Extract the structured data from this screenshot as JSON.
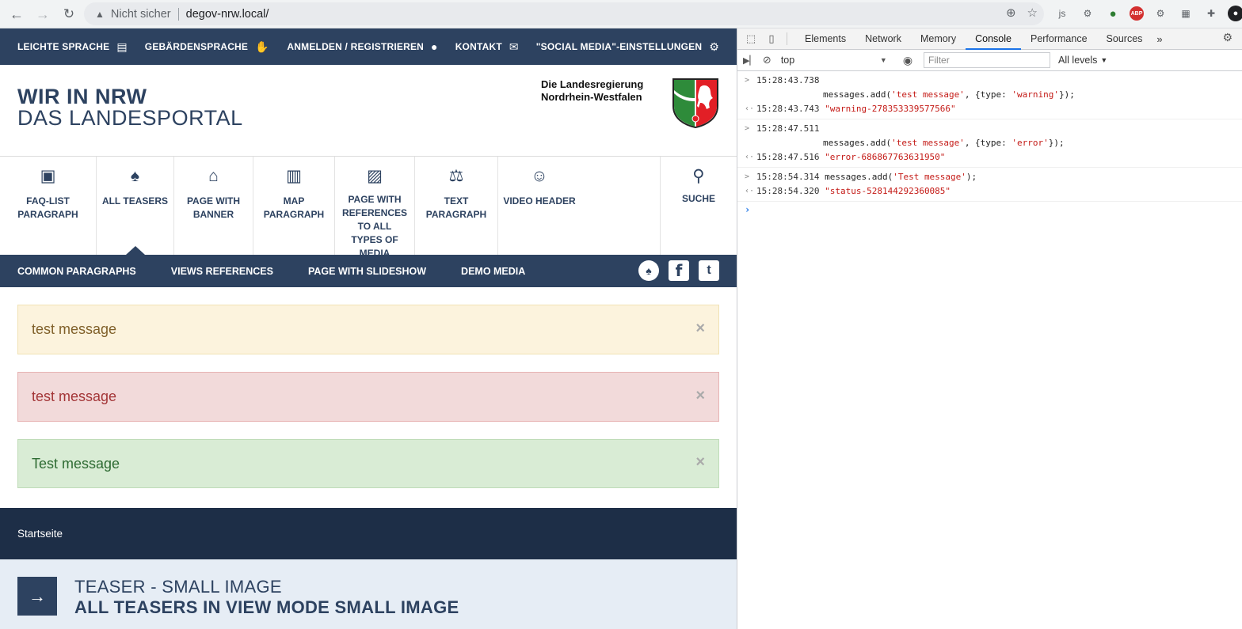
{
  "browser": {
    "security_label": "Nicht sicher",
    "url": "degov-nrw.local/",
    "icons": [
      "arrow-left-icon",
      "arrow-right-icon",
      "reload-icon",
      "warning-icon",
      "zoom-icon",
      "star-icon"
    ]
  },
  "extensions": {
    "js_label": "js",
    "abp_label": "ABP"
  },
  "site": {
    "topbar": {
      "left": [
        {
          "label": "LEICHTE SPRACHE",
          "icon": "book-icon"
        },
        {
          "label": "GEBÄRDENSPRACHE",
          "icon": "hand-icon"
        }
      ],
      "right": [
        {
          "label": "ANMELDEN / REGISTRIEREN",
          "icon": "user-icon"
        },
        {
          "label": "KONTAKT",
          "icon": "envelope-icon"
        },
        {
          "label": "\"SOCIAL MEDIA\"-EINSTELLUNGEN",
          "icon": "gears-icon"
        }
      ]
    },
    "title_line1": "WIR IN NRW",
    "title_line2": "DAS LANDESPORTAL",
    "gov_line1": "Die Landesregierung",
    "gov_line2": "Nordrhein-Westfalen",
    "main_nav": [
      {
        "label": "FAQ-LIST PARAGRAPH",
        "icon": "book-reader-icon"
      },
      {
        "label": "ALL TEASERS",
        "icon": "drupal-drop-icon",
        "active": true
      },
      {
        "label": "PAGE WITH BANNER",
        "icon": "landmark-icon"
      },
      {
        "label": "MAP PARAGRAPH",
        "icon": "map-icon"
      },
      {
        "label": "PAGE WITH REFERENCES TO ALL TYPES OF MEDIA",
        "icon": "image-icon"
      },
      {
        "label": "TEXT PARAGRAPH",
        "icon": "balance-scale-icon"
      },
      {
        "label": "VIDEO HEADER",
        "icon": "theater-masks-icon"
      }
    ],
    "search_label": "SUCHE",
    "sub_nav": [
      "COMMON PARAGRAPHS",
      "VIEWS REFERENCES",
      "PAGE WITH SLIDESHOW",
      "DEMO MEDIA"
    ],
    "social": {
      "facebook": "f",
      "twitter": "t"
    },
    "messages": [
      {
        "type": "warning",
        "text": "test message",
        "close": "×"
      },
      {
        "type": "error",
        "text": "test message",
        "close": "×"
      },
      {
        "type": "status",
        "text": "Test message",
        "close": "×"
      }
    ],
    "breadcrumb": "Startseite",
    "teaser": {
      "line1": "TEASER - SMALL IMAGE",
      "line2": "ALL TEASERS IN VIEW MODE SMALL IMAGE",
      "arrow": "→"
    }
  },
  "devtools": {
    "tabs": [
      "Elements",
      "Network",
      "Memory",
      "Console",
      "Performance",
      "Sources"
    ],
    "active_tab": "Console",
    "more": "»",
    "context": "top",
    "filter_placeholder": "Filter",
    "levels": "All levels",
    "log": [
      {
        "ts_in": "15:28:43.738",
        "cmd_pre": "messages.add(",
        "cmd_str": "'test message'",
        "cmd_mid": ", {type: ",
        "cmd_str2": "'warning'",
        "cmd_post": "});",
        "ts_out": "15:28:43.743",
        "result": "\"warning-278353339577566\""
      },
      {
        "ts_in": "15:28:47.511",
        "cmd_pre": "messages.add(",
        "cmd_str": "'test message'",
        "cmd_mid": ", {type: ",
        "cmd_str2": "'error'",
        "cmd_post": "});",
        "ts_out": "15:28:47.516",
        "result": "\"error-686867763631950\""
      },
      {
        "ts_in": "15:28:54.314",
        "cmd_pre": "messages.add(",
        "cmd_str": "'Test message'",
        "cmd_post": ");",
        "ts_out": "15:28:54.320",
        "result": "\"status-528144292360085\""
      }
    ]
  }
}
